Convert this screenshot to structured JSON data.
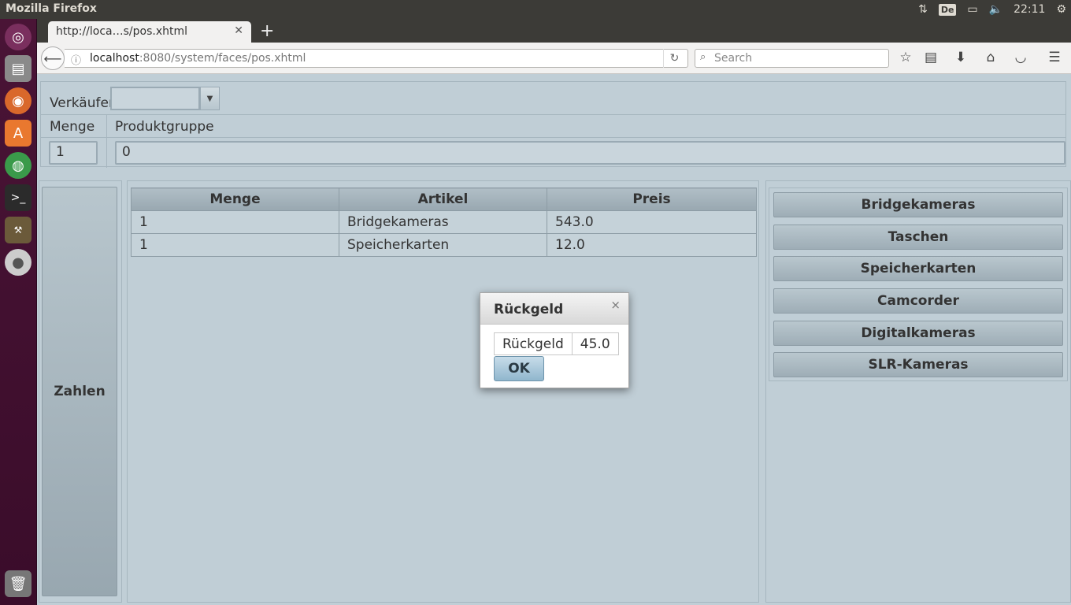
{
  "os_panel": {
    "app_title": "Mozilla Firefox",
    "keyboard_layout": "De",
    "clock": "22:11"
  },
  "launcher": {
    "icons": [
      "ubuntu-dash-icon",
      "files-icon",
      "firefox-icon",
      "software-center-icon",
      "chrome-icon",
      "terminal-icon",
      "netbeans-icon",
      "dvd-icon",
      "trash-icon"
    ]
  },
  "browser": {
    "tab_title": "http://loca…s/pos.xhtml",
    "url_host": "localhost",
    "url_rest": ":8080/system/faces/pos.xhtml",
    "search_placeholder": "Search"
  },
  "form": {
    "seller_label": "Verkäufer",
    "seller_value": "",
    "quantity_label": "Menge",
    "quantity_value": "1",
    "product_group_label": "Produktgruppe",
    "product_group_value": "0"
  },
  "pay_button": "Zahlen",
  "cart": {
    "headers": [
      "Menge",
      "Artikel",
      "Preis"
    ],
    "rows": [
      {
        "qty": "1",
        "article": "Bridgekameras",
        "price": "543.0"
      },
      {
        "qty": "1",
        "article": "Speicherkarten",
        "price": "12.0"
      }
    ]
  },
  "product_groups": [
    "Bridgekameras",
    "Taschen",
    "Speicherkarten",
    "Camcorder",
    "Digitalkameras",
    "SLR-Kameras"
  ],
  "dialog": {
    "title": "Rückgeld",
    "close": "×",
    "field_label": "Rückgeld",
    "field_value": "45.0",
    "ok_label": "OK"
  }
}
